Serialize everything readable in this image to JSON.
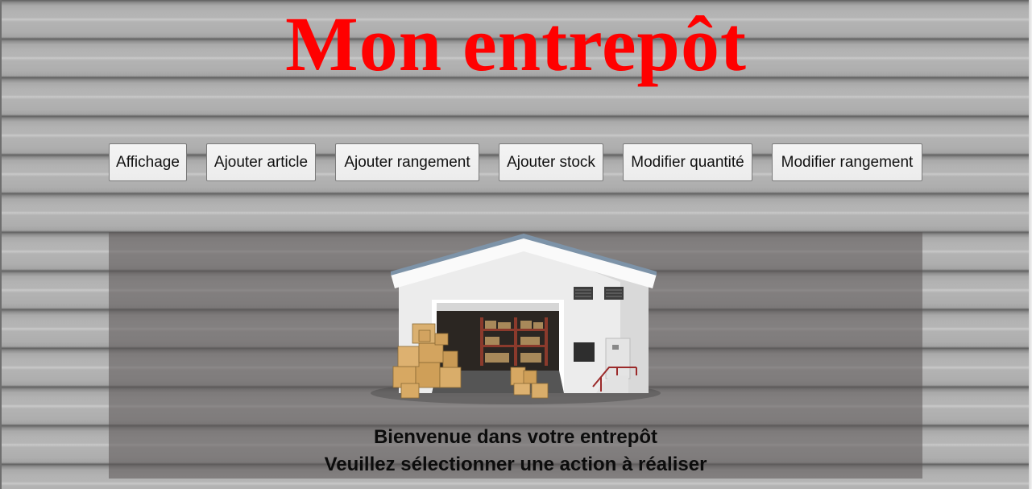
{
  "header": {
    "title": "Mon entrepôt"
  },
  "nav": {
    "buttons": [
      {
        "label": "Affichage"
      },
      {
        "label": "Ajouter article"
      },
      {
        "label": "Ajouter rangement"
      },
      {
        "label": "Ajouter stock"
      },
      {
        "label": "Modifier quantité"
      },
      {
        "label": "Modifier rangement"
      }
    ]
  },
  "main": {
    "illustration": "warehouse-illustration",
    "welcome_line1": "Bienvenue dans votre entrepôt",
    "welcome_line2": "Veuillez sélectionner une action à réaliser"
  },
  "colors": {
    "title": "#ff0000",
    "panel": "#5a5454",
    "background": "#b2b2b2"
  }
}
